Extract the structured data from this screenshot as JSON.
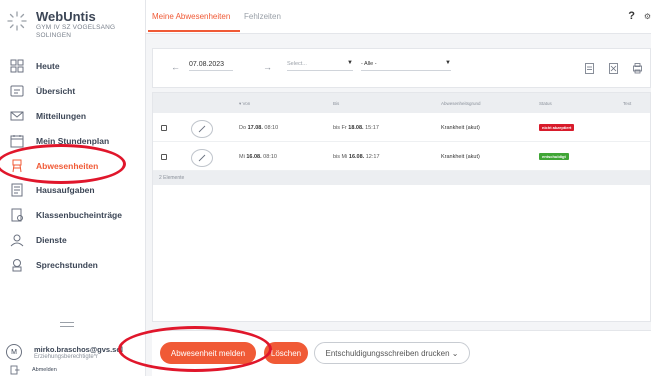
{
  "app": {
    "name": "WebUntis",
    "school_line1": "GYM IV SZ VOGELSANG",
    "school_line2": "SOLINGEN"
  },
  "nav": {
    "items": [
      {
        "label": "Heute",
        "icon": "grid-icon"
      },
      {
        "label": "Übersicht",
        "icon": "overview-icon"
      },
      {
        "label": "Mitteilungen",
        "icon": "mail-icon"
      },
      {
        "label": "Mein Stundenplan",
        "icon": "calendar-icon"
      },
      {
        "label": "Abwesenheiten",
        "icon": "absence-icon",
        "active": true
      },
      {
        "label": "Hausaufgaben",
        "icon": "homework-icon"
      },
      {
        "label": "Klassenbucheinträge",
        "icon": "classbook-icon"
      },
      {
        "label": "Dienste",
        "icon": "person-icon"
      },
      {
        "label": "Sprechstunden",
        "icon": "consult-icon"
      }
    ]
  },
  "user": {
    "initial": "M",
    "name": "mirko.braschos@gvs.sol",
    "role": "Erziehungsberechtigte*r",
    "logout": "Abmelden"
  },
  "tabs": {
    "absences": "Meine Abwesenheiten",
    "lateness": "Fehlzeiten",
    "help": "?"
  },
  "filters": {
    "date": "07.08.2023",
    "select_placeholder": "Select...",
    "status_value": "- Alle -"
  },
  "table": {
    "columns": [
      "▾ Von",
      "Bis",
      "Abwesenheitsgrund",
      "Status",
      "Text"
    ],
    "rows": [
      {
        "from_day": "Do",
        "from_date": "17.08.",
        "from_time": "08:10",
        "to_prefix": "bis Fr",
        "to_date": "18.08.",
        "to_time": "15:17",
        "reason": "Krankheit (akut)",
        "status": "nicht akzeptiert",
        "status_color": "#d81b2b"
      },
      {
        "from_day": "Mi",
        "from_date": "16.08.",
        "from_time": "08:10",
        "to_prefix": "bis Mi",
        "to_date": "16.08.",
        "to_time": "12:17",
        "reason": "Krankheit (akut)",
        "status": "entschuldigt",
        "status_color": "#3fa535"
      }
    ],
    "count_label": "2 Elemente"
  },
  "actions": {
    "report": "Abwesenheit melden",
    "delete": "Löschen",
    "print": "Entschuldigungsschreiben drucken ⌄"
  },
  "colors": {
    "accent": "#f05a36",
    "annotation": "#e0162b"
  }
}
